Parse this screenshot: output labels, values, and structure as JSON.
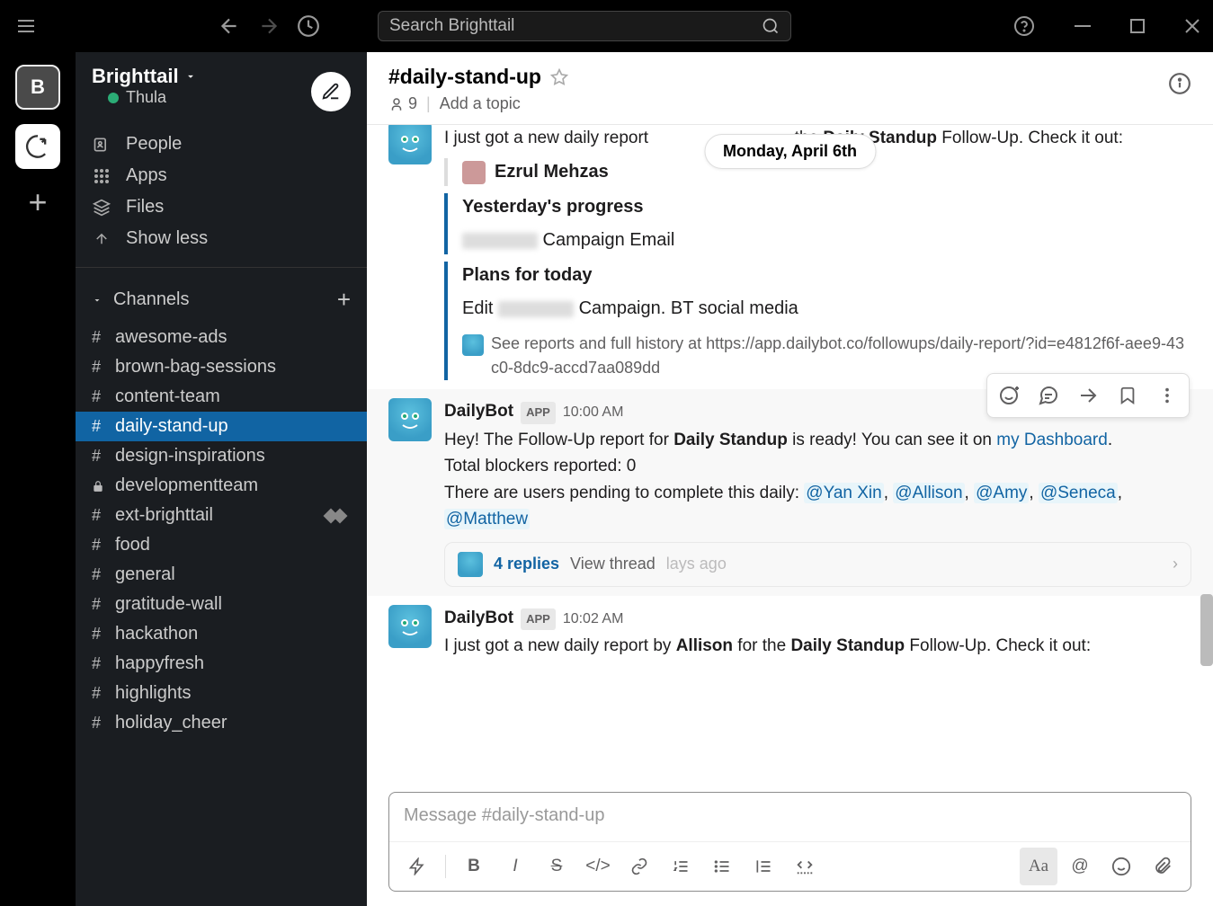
{
  "titlebar": {
    "search_placeholder": "Search Brighttail"
  },
  "rail": {
    "workspaces": [
      "B",
      "↻"
    ],
    "add": "+"
  },
  "sidebar": {
    "workspace_name": "Brighttail",
    "user_name": "Thula",
    "nav": {
      "people": "People",
      "apps": "Apps",
      "files": "Files",
      "show_less": "Show less"
    },
    "channels_header": "Channels",
    "channels": [
      {
        "prefix": "#",
        "name": "awesome-ads"
      },
      {
        "prefix": "#",
        "name": "brown-bag-sessions"
      },
      {
        "prefix": "#",
        "name": "content-team"
      },
      {
        "prefix": "#",
        "name": "daily-stand-up",
        "active": true
      },
      {
        "prefix": "#",
        "name": "design-inspirations"
      },
      {
        "prefix": "🔒",
        "name": "developmentteam"
      },
      {
        "prefix": "#",
        "name": "ext-brighttail",
        "ext": true
      },
      {
        "prefix": "#",
        "name": "food"
      },
      {
        "prefix": "#",
        "name": "general"
      },
      {
        "prefix": "#",
        "name": "gratitude-wall"
      },
      {
        "prefix": "#",
        "name": "hackathon"
      },
      {
        "prefix": "#",
        "name": "happyfresh"
      },
      {
        "prefix": "#",
        "name": "highlights"
      },
      {
        "prefix": "#",
        "name": "holiday_cheer"
      }
    ]
  },
  "channel_header": {
    "name": "#daily-stand-up",
    "member_count": "9",
    "add_topic": "Add a topic"
  },
  "date_divider": "Monday, April 6th",
  "messages": {
    "m1": {
      "body_before": "I just got a new daily report ",
      "body_mid": " the ",
      "body_bold": "Daily Standup",
      "body_after": " Follow-Up. Check it out:",
      "att_user": "Ezrul Mehzas",
      "att_h1": "Yesterday's progress",
      "att_t1": " Campaign Email",
      "att_h2": "Plans for today",
      "att_t2a": "Edit ",
      "att_t2b": " Campaign. BT social media",
      "footer": "See reports and full history at https://app.dailybot.co/followups/daily-report/?id=e4812f6f-aee9-43c0-8dc9-accd7aa089dd"
    },
    "m2": {
      "author": "DailyBot",
      "badge": "APP",
      "time": "10:00 AM",
      "l1a": "Hey! The Follow-Up report for ",
      "l1b": "Daily Standup",
      "l1c": " is ready! You can see it on ",
      "l1link": "my Dashboard",
      "l1d": ".",
      "l2": "Total blockers reported: 0",
      "l3": "There are users pending to complete this daily: ",
      "mentions": [
        "@Yan Xin",
        "@Allison",
        "@Amy",
        "@Seneca",
        "@Matthew"
      ],
      "thread_count": "4 replies",
      "thread_view": "View thread",
      "thread_ago": "lays ago"
    },
    "m3": {
      "author": "DailyBot",
      "badge": "APP",
      "time": "10:02 AM",
      "l1a": "I just got a new daily report by ",
      "l1b": "Allison",
      "l1c": " for the ",
      "l1d": "Daily Standup",
      "l1e": " Follow-Up. Check it out:"
    }
  },
  "composer": {
    "placeholder": "Message #daily-stand-up"
  }
}
